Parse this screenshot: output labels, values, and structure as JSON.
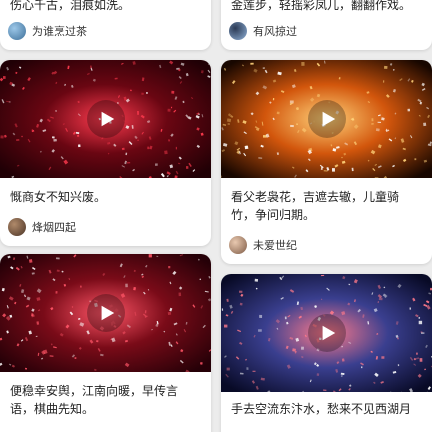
{
  "feed": {
    "cards": [
      {
        "caption": "伤心千古，泪痕如洗。",
        "author": "为谁烹过茶",
        "avatar_colors": [
          "#9cc7e8",
          "#3d6f99"
        ],
        "has_video": false
      },
      {
        "caption": "金莲步，轻摇彩凤儿，翻翻作戏。",
        "author": "有风掠过",
        "avatar_colors": [
          "#2b3a55",
          "#8fb0d6"
        ],
        "has_video": false
      },
      {
        "caption": "慨商女不知兴废。",
        "author": "烽烟四起",
        "avatar_colors": [
          "#b08a6a",
          "#4a3326"
        ],
        "has_video": true,
        "thumb_colors": [
          "#ff3b4f",
          "#6a0612",
          "#200005"
        ]
      },
      {
        "caption": "看父老袅花，吉遮去辙，儿童骑竹，争问归期。",
        "author": "未爱世纪",
        "avatar_colors": [
          "#e9c9b0",
          "#7d5a45"
        ],
        "has_video": true,
        "thumb_colors": [
          "#ffd27a",
          "#d2560c",
          "#180700"
        ]
      },
      {
        "caption": "便稳幸安舆，江南向暖，早传言语，棋曲先知。",
        "author": "",
        "has_video": true,
        "thumb_colors": [
          "#ff5567",
          "#7a0b18",
          "#250007"
        ]
      },
      {
        "caption": "手去空流东汴水，愁来不见西湖月",
        "author": "",
        "has_video": true,
        "thumb_colors": [
          "#ff7a8a",
          "#3a3f8f",
          "#080a26"
        ]
      }
    ]
  }
}
